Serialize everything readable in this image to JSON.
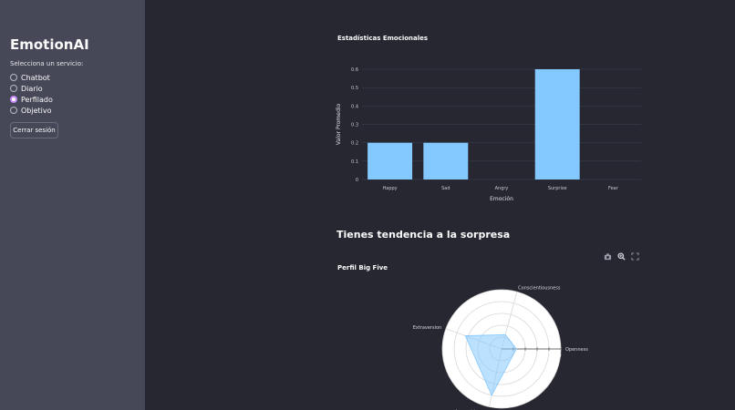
{
  "sidebar": {
    "app_title": "EmotionAI",
    "select_label": "Selecciona un servicio:",
    "options": [
      {
        "label": "Chatbot",
        "selected": false
      },
      {
        "label": "Diario",
        "selected": false
      },
      {
        "label": "Perfilado",
        "selected": true
      },
      {
        "label": "Objetivo",
        "selected": false
      }
    ],
    "logout_label": "Cerrar sesión"
  },
  "main": {
    "tendency_heading": "Tienes tendencia a la sorpresa",
    "toolbar": {
      "icons": [
        "camera-icon",
        "zoom-icon",
        "fullscreen-icon"
      ]
    }
  },
  "chart_data": [
    {
      "type": "bar",
      "title": "Estadísticas Emocionales",
      "xlabel": "Emoción",
      "ylabel": "Valor Promedio",
      "categories": [
        "Happy",
        "Sad",
        "Angry",
        "Surprise",
        "Fear"
      ],
      "values": [
        0.2,
        0.2,
        0,
        0.6,
        0
      ],
      "ylim": [
        0,
        0.6
      ],
      "yticks": [
        "0",
        "0.1",
        "0.2",
        "0.3",
        "0.4",
        "0.5",
        "0.6"
      ],
      "bar_color": "#83c9ff",
      "grid": true
    },
    {
      "type": "radar",
      "title": "Perfil Big Five",
      "axes": [
        "Openness",
        "Conscientiousness",
        "Extraversion",
        "Agreeableness"
      ],
      "values": [
        0.25,
        0.25,
        0.65,
        0.8
      ],
      "range": [
        0,
        1
      ],
      "radial_tick_label": "0",
      "fill_color": "#83c9ff"
    }
  ]
}
